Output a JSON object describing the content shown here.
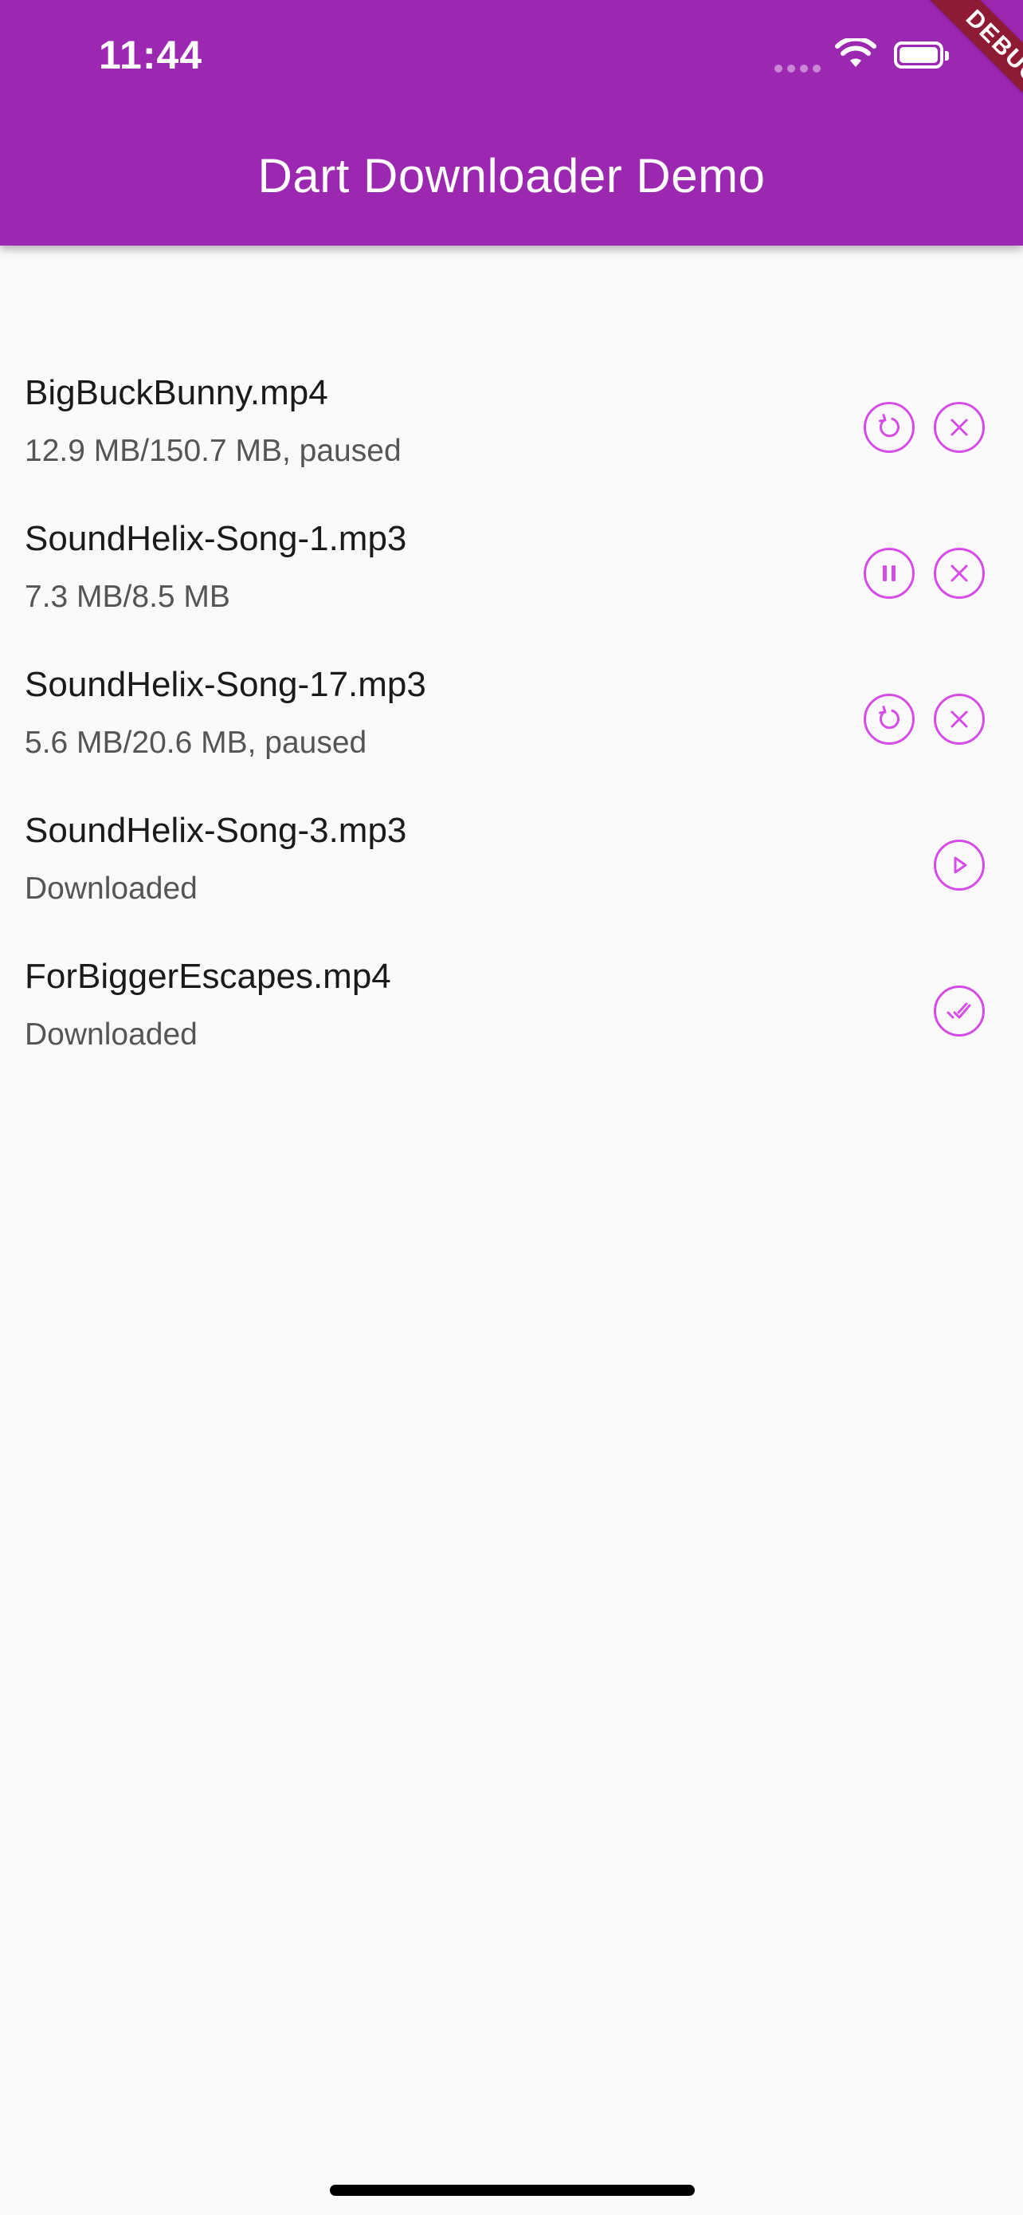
{
  "status_bar": {
    "time": "11:44"
  },
  "app_bar": {
    "title": "Dart Downloader Demo",
    "debug_label": "DEBUG"
  },
  "colors": {
    "app_bar": "#9c27b0",
    "accent_icon": "#d54ce6",
    "background": "#fafafa",
    "debug_ribbon": "#8e1b33"
  },
  "downloads": [
    {
      "filename": "BigBuckBunny.mp4",
      "status": "12.9 MB/150.7 MB, paused",
      "actions": [
        "resume-icon",
        "cancel-icon"
      ]
    },
    {
      "filename": "SoundHelix-Song-1.mp3",
      "status": "7.3 MB/8.5 MB",
      "actions": [
        "pause-icon",
        "cancel-icon"
      ]
    },
    {
      "filename": "SoundHelix-Song-17.mp3",
      "status": "5.6 MB/20.6 MB, paused",
      "actions": [
        "resume-icon",
        "cancel-icon"
      ]
    },
    {
      "filename": "SoundHelix-Song-3.mp3",
      "status": "Downloaded",
      "actions": [
        "play-icon"
      ]
    },
    {
      "filename": "ForBiggerEscapes.mp4",
      "status": "Downloaded",
      "actions": [
        "done-all-icon"
      ]
    }
  ]
}
